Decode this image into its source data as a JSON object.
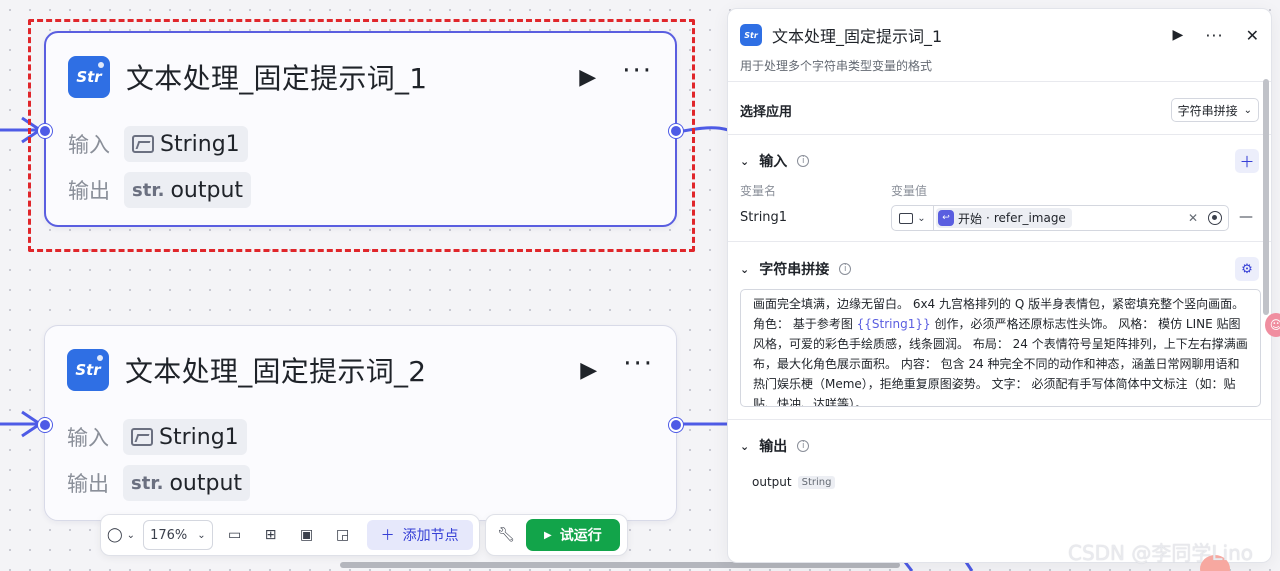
{
  "nodes": [
    {
      "title": "文本处理_固定提示词_1",
      "input_label": "输入",
      "input_value": "String1",
      "output_label": "输出",
      "output_type_icon": "str.",
      "output_value": "output"
    },
    {
      "title": "文本处理_固定提示词_2",
      "input_label": "输入",
      "input_value": "String1",
      "output_label": "输出",
      "output_type_icon": "str.",
      "output_value": "output"
    }
  ],
  "node_icon_text": "Str",
  "toolbar": {
    "zoom": "176%",
    "add_node_label": "添加节点",
    "run_label": "试运行"
  },
  "panel": {
    "title": "文本处理_固定提示词_1",
    "subtitle": "用于处理多个字符串类型变量的格式",
    "select_app_label": "选择应用",
    "select_app_value": "字符串拼接",
    "input_section": "输入",
    "col_name": "变量名",
    "col_value": "变量值",
    "var_name": "String1",
    "var_ref_source": "开始",
    "var_ref_sep": " · ",
    "var_ref_field": "refer_image",
    "concat_section": "字符串拼接",
    "prompt_before": "画面完全填满，边缘无留白。 6x4 九宫格排列的 Q 版半身表情包，紧密填充整个竖向画面。 角色： 基于参考图 ",
    "prompt_ref": "{{String1}}",
    "prompt_after": " 创作，必须严格还原标志性头饰。 风格： 模仿 LINE 贴图风格，可爱的彩色手绘质感，线条圆润。 布局： 24 个表情符号呈矩阵排列，上下左右撑满画布，最大化角色展示面积。 内容： 包含 24 种完全不同的动作和神态，涵盖日常网聊用语和热门娱乐梗（Meme），拒绝重复原图姿势。 文字： 必须配有手写体简体中文标注（如：贴贴、快冲、达咩等）。",
    "output_section": "输出",
    "output_name": "output",
    "output_type": "String"
  },
  "watermark": "CSDN @李同学Lino",
  "colors": {
    "accent": "#5a5ee0",
    "node_icon": "#2f6fe4",
    "run_button": "#12a44a",
    "selection": "#e0262b",
    "port": "#4e5be6"
  },
  "icons": {
    "play": "play-icon",
    "more": "more-icon",
    "close": "close-icon",
    "info": "info-icon",
    "settings": "gear-icon"
  }
}
